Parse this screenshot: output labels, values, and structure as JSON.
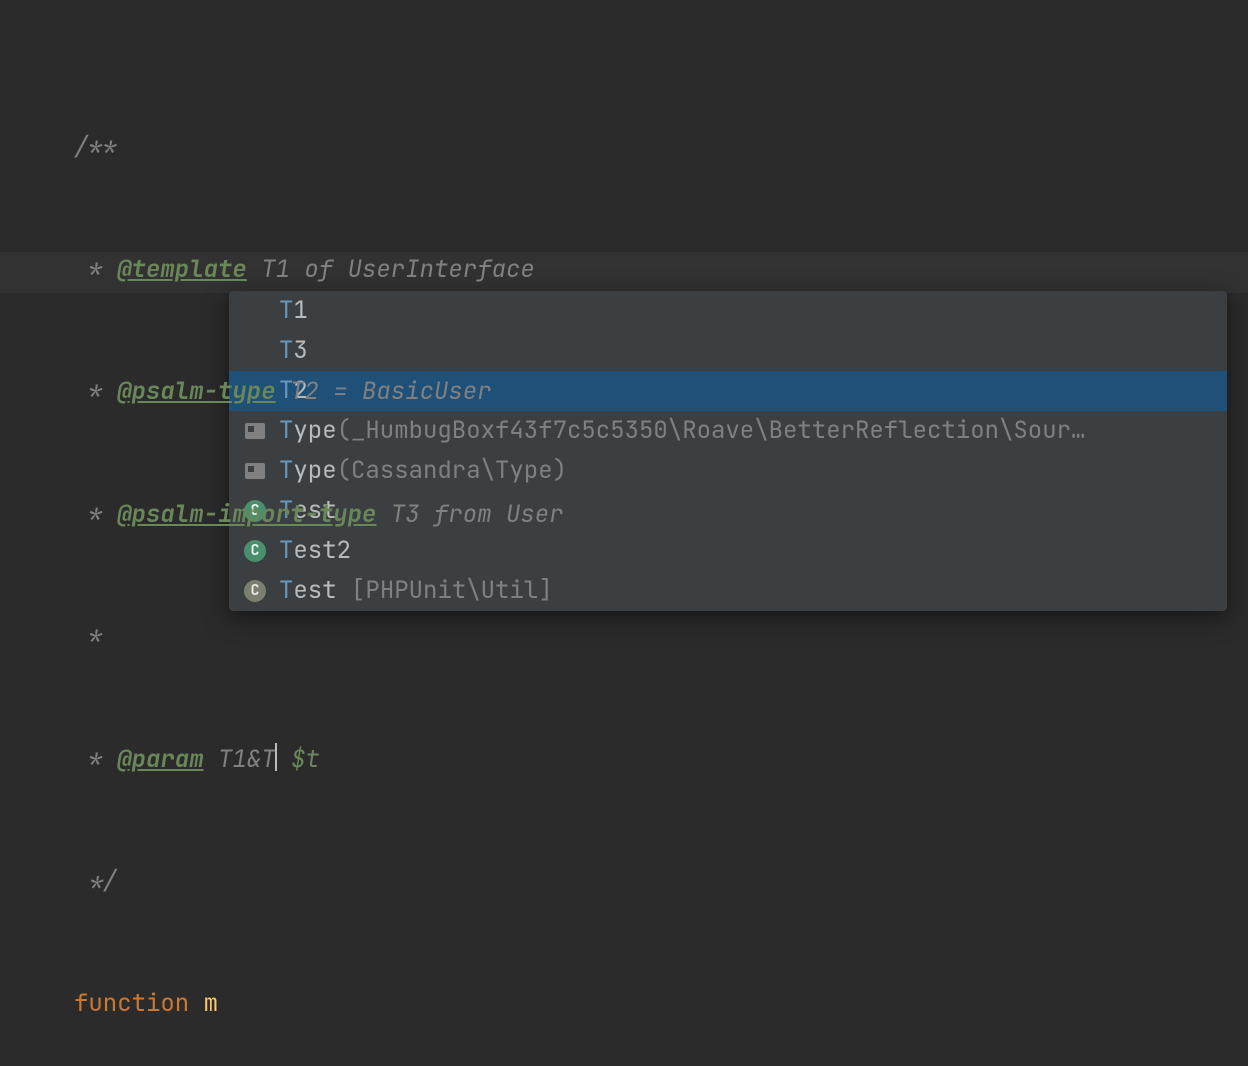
{
  "doc": {
    "start": "/**",
    "star": " *",
    "line1_star": " * ",
    "line1_tag": "@template",
    "line1_rest": " T1 of UserInterface",
    "line2_star": " * ",
    "line2_tag": "@psalm-type",
    "line2_rest": " T2 = BasicUser",
    "line3_star": " * ",
    "line3_tag": "@psalm-import-type",
    "line3_rest": " T3 from User",
    "line4_star": " * ",
    "line4_tag": "@param",
    "line4_type": " T1&T",
    "line4_var": " $t",
    "end": " */"
  },
  "code": {
    "kw": "function",
    "sp": " ",
    "fn": "m"
  },
  "popup": {
    "items": [
      {
        "icon": "blank",
        "hl": "T",
        "rest": "1",
        "hint": ""
      },
      {
        "icon": "blank",
        "hl": "T",
        "rest": "3",
        "hint": ""
      },
      {
        "icon": "blank",
        "hl": "T",
        "rest": "2",
        "hint": "",
        "selected": true
      },
      {
        "icon": "ns",
        "hl": "T",
        "rest": "ype",
        "hint": "(_HumbugBoxf43f7c5c5350\\Roave\\BetterReflection\\Sour…"
      },
      {
        "icon": "ns",
        "hl": "T",
        "rest": "ype",
        "hint": "(Cassandra\\Type)"
      },
      {
        "icon": "class",
        "hl": "T",
        "rest": "est",
        "hint": ""
      },
      {
        "icon": "class",
        "hl": "T",
        "rest": "est2",
        "hint": ""
      },
      {
        "icon": "class-muted",
        "hl": "T",
        "rest": "est ",
        "hint": "[PHPUnit\\Util]"
      }
    ],
    "class_glyph": "C"
  }
}
